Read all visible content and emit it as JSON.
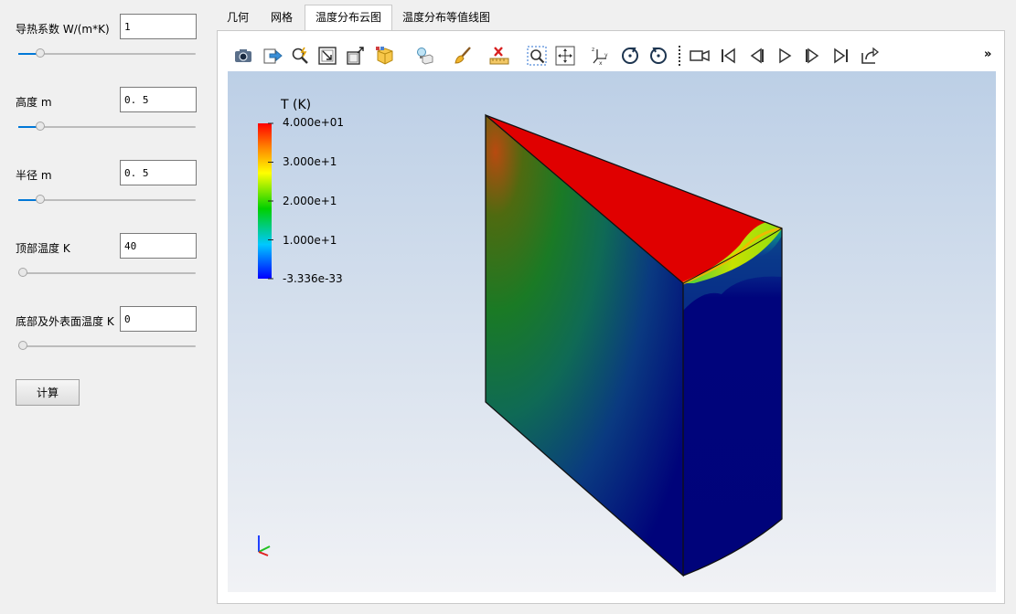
{
  "params": [
    {
      "label": "导热系数 W/(m*K)",
      "value": "1",
      "slider": 0.1
    },
    {
      "label": "高度 m",
      "value": "0. 5",
      "slider": 0.1
    },
    {
      "label": "半径 m",
      "value": "0. 5",
      "slider": 0.1
    },
    {
      "label": "顶部温度 K",
      "value": "40",
      "slider": 0.0
    },
    {
      "label": "底部及外表面温度 K",
      "value": "0",
      "slider": 0.0
    }
  ],
  "calc_label": "计算",
  "tabs": [
    {
      "label": "几何",
      "active": false
    },
    {
      "label": "网格",
      "active": false
    },
    {
      "label": "温度分布云图",
      "active": true
    },
    {
      "label": "温度分布等值线图",
      "active": false
    }
  ],
  "toolbar": {
    "icons": [
      "camera-icon",
      "export-icon",
      "zoom-tool-icon",
      "reset-camera-icon",
      "zoom-box-icon",
      "cube-view-icon",
      "light-bulb-icon",
      "brush-icon",
      "ruler-delete-icon",
      "zoom-fit-icon",
      "pan-icon",
      "axes-orientation-icon",
      "rotate-cw-icon",
      "rotate-ccw-icon",
      "video-camera-icon",
      "first-frame-icon",
      "previous-frame-icon",
      "play-icon",
      "next-frame-icon",
      "last-frame-icon",
      "loop-icon"
    ],
    "overflow": "»"
  },
  "colorbar": {
    "title": "T (K)",
    "ticks": [
      "4.000e+01",
      "3.000e+1",
      "2.000e+1",
      "1.000e+1",
      "-3.336e-33"
    ],
    "max": 40,
    "min": -3.336e-33
  },
  "colors": {
    "accent": "#0078d7",
    "hot": "#e00000",
    "cold": "#00037a",
    "background_top": "#bccfe6",
    "background_bottom": "#f1f2f5"
  }
}
